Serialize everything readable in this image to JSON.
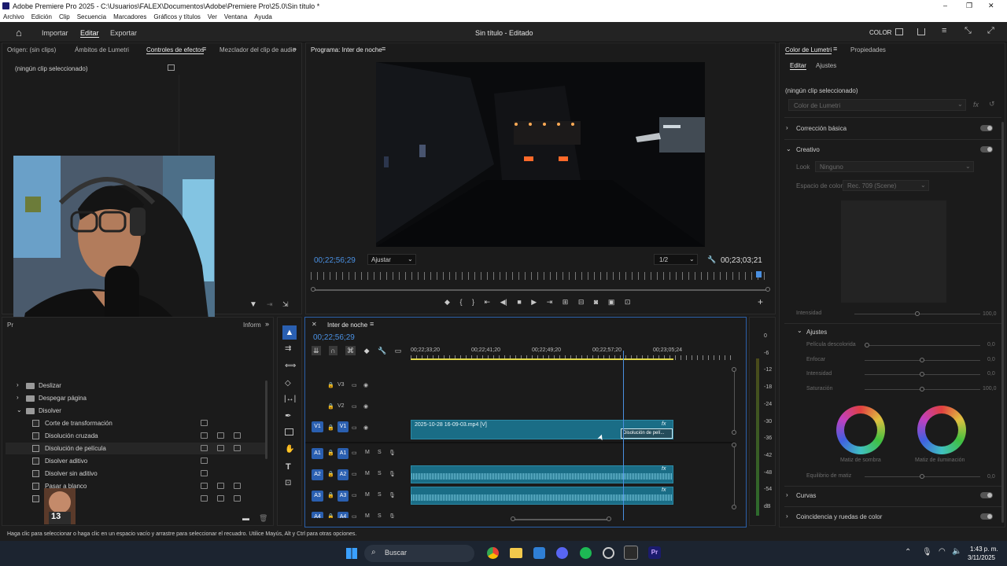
{
  "app": {
    "title": "Adobe Premiere Pro 2025 - C:\\Usuarios\\FALEX\\Documentos\\Adobe\\Premiere Pro\\25.0\\Sin título *",
    "menu": [
      "Archivo",
      "Edición",
      "Clip",
      "Secuencia",
      "Marcadores",
      "Gráficos y títulos",
      "Ver",
      "Ventana",
      "Ayuda"
    ],
    "window_controls": {
      "min": "–",
      "max": "❐",
      "close": "✕"
    }
  },
  "workspace": {
    "tabs": [
      "Importar",
      "Editar",
      "Exportar"
    ],
    "active_tab": "Editar",
    "project_title": "Sin título - Editado",
    "color_label": "COLOR"
  },
  "source_panel": {
    "tabs": [
      "Origen: (sin clips)",
      "Ámbitos de Lumetri",
      "Controles de efectos",
      "Mezclador del clip de audio"
    ],
    "active": "Controles de efectos",
    "no_clip": "(ningún clip seleccionado)"
  },
  "program": {
    "title": "Programa: Inter de noche",
    "timecode_left": "00;22;56;29",
    "fit": "Ajustar",
    "resolution": "1/2",
    "timecode_right": "00;23;03;21",
    "playhead_progress": 0.985
  },
  "effects": {
    "tab_right": "Inform",
    "tab_left": "Pr",
    "items": [
      {
        "name": "Deslizar",
        "type": "folder",
        "open": false,
        "indent": 1,
        "badges": 0
      },
      {
        "name": "Despegar página",
        "type": "folder",
        "open": false,
        "indent": 1,
        "badges": 0
      },
      {
        "name": "Disolver",
        "type": "folder",
        "open": true,
        "indent": 1,
        "badges": 0
      },
      {
        "name": "Corte de transformación",
        "type": "fx",
        "indent": 2,
        "badges": 1
      },
      {
        "name": "Disolución cruzada",
        "type": "fx",
        "indent": 2,
        "badges": 3
      },
      {
        "name": "Disolución de película",
        "type": "fx",
        "indent": 2,
        "badges": 3,
        "selected": true
      },
      {
        "name": "Disolver aditivo",
        "type": "fx",
        "indent": 2,
        "badges": 1
      },
      {
        "name": "Disolver sin aditivo",
        "type": "fx",
        "indent": 2,
        "badges": 1
      },
      {
        "name": "Pasar a blanco",
        "type": "fx",
        "indent": 2,
        "badges": 3
      },
      {
        "name": "P",
        "type": "fx",
        "indent": 2,
        "badges": 3
      }
    ],
    "avatar_label": "13"
  },
  "timeline": {
    "title": "Inter de noche",
    "timecode": "00;22;56;29",
    "ruler": [
      "00;22;33;20",
      "00;22;41;20",
      "00;22;49;20",
      "00;22;57;20",
      "00;23;05;24"
    ],
    "playhead_frac": 0.655,
    "video_tracks": [
      {
        "id": "V3",
        "src": "",
        "locked": false
      },
      {
        "id": "V2",
        "src": "",
        "locked": false
      },
      {
        "id": "V1",
        "src": "V1",
        "locked": false
      }
    ],
    "audio_tracks": [
      {
        "id": "A1",
        "src": "A1"
      },
      {
        "id": "A2",
        "src": "A2"
      },
      {
        "id": "A3",
        "src": "A3"
      },
      {
        "id": "A4",
        "src": "A4"
      }
    ],
    "clip_label": "2025-10-28 16-09-03.mp4 [V]",
    "transition_label": "Disolución de pelí...",
    "fx": "fx",
    "meter_scale": [
      "0",
      "-6",
      "-12",
      "-18",
      "-24",
      "-30",
      "-36",
      "-42",
      "-48",
      "-54",
      "dB"
    ]
  },
  "lumetri": {
    "tabs": [
      "Color de Lumetri",
      "Propiedades"
    ],
    "subtabs": [
      "Editar",
      "Ajustes"
    ],
    "no_clip": "(ningún clip seleccionado)",
    "preset": "Color de Lumetri",
    "sections": {
      "basic": "Corrección básica",
      "creative": "Creativo",
      "curves": "Curvas",
      "match": "Coincidencia y ruedas de color"
    },
    "look_label": "Look",
    "look_value": "Ninguno",
    "colorspace_label": "Espacio de color",
    "colorspace_value": "Rec. 709 (Scene)",
    "intensity_label": "Intensidad",
    "intensity_value": "100,0",
    "adjust_title": "Ajustes",
    "adjust_rows": [
      {
        "label": "Película descolorida",
        "value": "0,0",
        "pos": 0.0
      },
      {
        "label": "Enfocar",
        "value": "0,0",
        "pos": 0.5
      },
      {
        "label": "Intensidad",
        "value": "0,0",
        "pos": 0.5
      },
      {
        "label": "Saturación",
        "value": "100,0",
        "pos": 0.5
      }
    ],
    "wheel_labels": [
      "Matiz de sombra",
      "Matiz de iluminación"
    ],
    "balance_label": "Equilibrio de matiz",
    "balance_value": "0,0"
  },
  "status": {
    "hint": "Haga clic para seleccionar o haga clic en un espacio vacío y arrastre para seleccionar el recuadro. Utilice Mayús, Alt y Ctrl para otras opciones."
  },
  "taskbar": {
    "search": "Buscar",
    "time": "1:43 p. m.",
    "date": "3/11/2025"
  }
}
